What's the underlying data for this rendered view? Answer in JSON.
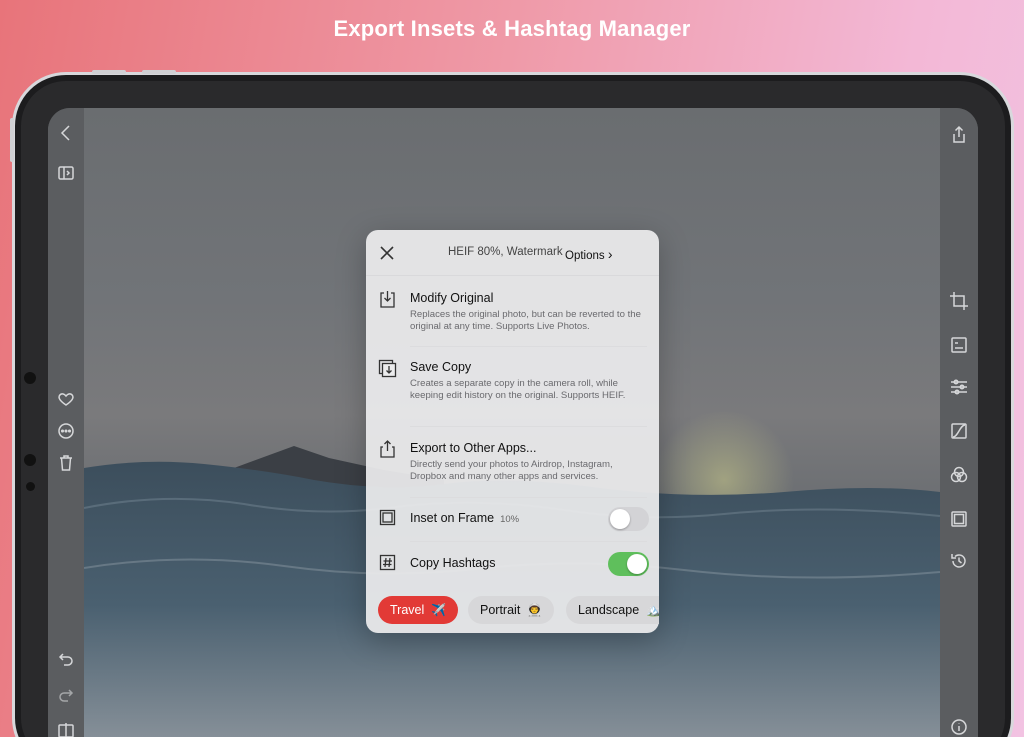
{
  "headline": "Export Insets & Hashtag Manager",
  "export_sheet": {
    "format_summary": "HEIF 80%, Watermark",
    "options_label": "Options",
    "options_chevron": "›",
    "items": [
      {
        "title": "Modify Original",
        "description": "Replaces the original photo, but can be reverted to the original at any time. Supports Live Photos.",
        "icon": "import-icon"
      },
      {
        "title": "Save Copy",
        "description": "Creates a separate copy in the camera roll, while keeping edit history on the original. Supports HEIF.",
        "icon": "save-copy-icon"
      },
      {
        "title": "Export to Other Apps...",
        "description": "Directly send your photos to Airdrop, Instagram, Dropbox and many other apps and services.",
        "icon": "share-icon"
      }
    ],
    "toggles": [
      {
        "label": "Inset on Frame",
        "value": "10%",
        "on": false,
        "icon": "frame-icon"
      },
      {
        "label": "Copy Hashtags",
        "on": true,
        "icon": "hashtag-icon"
      }
    ],
    "hashtag_chips": [
      {
        "label": "Travel",
        "emoji": "✈️",
        "active": true
      },
      {
        "label": "Portrait",
        "emoji": "👨‍🚀",
        "active": false
      },
      {
        "label": "Landscape",
        "emoji": "🏔️",
        "active": false
      }
    ]
  },
  "colors": {
    "accent_red": "#e23a36",
    "toggle_green": "#5fbf5c",
    "background_gradient_start": "#e8747a",
    "background_gradient_end": "#f2c3e2"
  }
}
